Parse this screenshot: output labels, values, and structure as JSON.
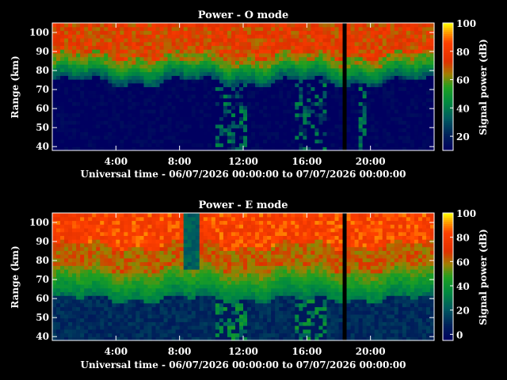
{
  "chart_data": [
    {
      "type": "heatmap",
      "title": "Power - O mode",
      "xlabel": "Universal time - 06/07/2026 00:00:00 to 07/07/2026 00:00:00",
      "ylabel": "Range (km)",
      "x_range_hours": [
        0,
        24
      ],
      "x_tick_hours": [
        4,
        8,
        12,
        16,
        20
      ],
      "x_tick_labels": [
        "4:00",
        "8:00",
        "12:00",
        "16:00",
        "20:00"
      ],
      "y_range_km": [
        38,
        105
      ],
      "y_ticks": [
        40,
        50,
        60,
        70,
        80,
        90,
        100
      ],
      "colorbar_label": "Signal power (dB)",
      "colorbar_range": [
        10,
        100
      ],
      "colorbar_ticks": [
        20,
        40,
        60,
        80,
        100
      ],
      "profile": {
        "hot_top_km": 88,
        "green_band_km": [
          74,
          84
        ],
        "floor_db": 5,
        "peak_db": 72,
        "noise_columns_hours": [
          10.5,
          11.0,
          11.5,
          12.0,
          15.5,
          16.0,
          16.5,
          17.0,
          19.5
        ],
        "gap_hours": [
          18.4
        ]
      }
    },
    {
      "type": "heatmap",
      "title": "Power - E mode",
      "xlabel": "Universal time - 06/07/2026 00:00:00 to 07/07/2026 00:00:00",
      "ylabel": "Range (km)",
      "x_range_hours": [
        0,
        24
      ],
      "x_tick_hours": [
        4,
        8,
        12,
        16,
        20
      ],
      "x_tick_labels": [
        "4:00",
        "8:00",
        "12:00",
        "16:00",
        "20:00"
      ],
      "y_range_km": [
        38,
        105
      ],
      "y_ticks": [
        40,
        50,
        60,
        70,
        80,
        90,
        100
      ],
      "colorbar_label": "Signal power (dB)",
      "colorbar_range": [
        -5,
        100
      ],
      "colorbar_ticks": [
        0,
        20,
        40,
        60,
        80,
        100
      ],
      "profile": {
        "hot_top_km": 88,
        "green_band_km": [
          60,
          76
        ],
        "floor_db": 5,
        "peak_db": 80,
        "noise_columns_hours": [
          10.5,
          11.0,
          11.5,
          12.0,
          15.5,
          16.0,
          16.5,
          17.0
        ],
        "gap_hours": [
          18.4
        ],
        "blue_columns_hours": [
          8.5,
          9.0
        ]
      }
    }
  ]
}
